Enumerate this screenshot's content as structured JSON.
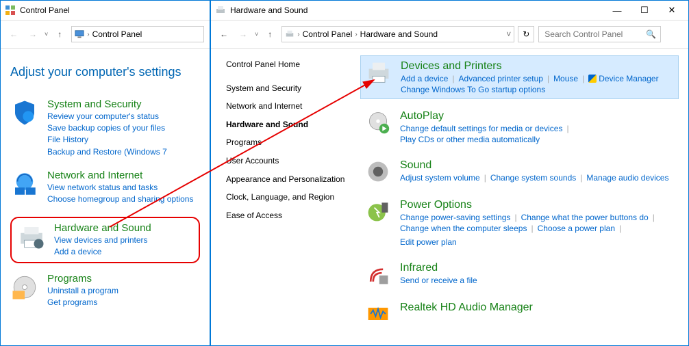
{
  "left_window": {
    "title": "Control Panel",
    "breadcrumb": [
      "Control Panel"
    ],
    "heading": "Adjust your computer's settings",
    "categories": [
      {
        "title": "System and Security",
        "links": [
          "Review your computer's status",
          "Save backup copies of your files",
          "File History",
          "Backup and Restore (Windows 7"
        ]
      },
      {
        "title": "Network and Internet",
        "links": [
          "View network status and tasks",
          "Choose homegroup and sharing options"
        ]
      },
      {
        "title": "Hardware and Sound",
        "links": [
          "View devices and printers",
          "Add a device"
        ]
      },
      {
        "title": "Programs",
        "links": [
          "Uninstall a program",
          "Get programs"
        ]
      }
    ]
  },
  "right_window": {
    "title": "Hardware and Sound",
    "breadcrumb": [
      "Control Panel",
      "Hardware and Sound"
    ],
    "search_placeholder": "Search Control Panel",
    "sidebar": [
      "Control Panel Home",
      "System and Security",
      "Network and Internet",
      "Hardware and Sound",
      "Programs",
      "User Accounts",
      "Appearance and Personalization",
      "Clock, Language, and Region",
      "Ease of Access"
    ],
    "sidebar_active_index": 3,
    "sections": [
      {
        "title": "Devices and Printers",
        "highlighted": true,
        "links": [
          "Add a device",
          "Advanced printer setup",
          "Mouse",
          "Device Manager"
        ],
        "extra_links": [
          "Change Windows To Go startup options"
        ],
        "shield_index": 3
      },
      {
        "title": "AutoPlay",
        "links": [
          "Change default settings for media or devices"
        ],
        "extra_links": [
          "Play CDs or other media automatically"
        ]
      },
      {
        "title": "Sound",
        "links": [
          "Adjust system volume",
          "Change system sounds",
          "Manage audio devices"
        ]
      },
      {
        "title": "Power Options",
        "links": [
          "Change power-saving settings",
          "Change what the power buttons do"
        ],
        "extra_links": [
          "Change when the computer sleeps",
          "Choose a power plan",
          "Edit power plan"
        ]
      },
      {
        "title": "Infrared",
        "links": [
          "Send or receive a file"
        ]
      },
      {
        "title": "Realtek HD Audio Manager",
        "links": []
      }
    ]
  },
  "winbtns": {
    "min": "—",
    "max": "☐",
    "close": "✕"
  }
}
